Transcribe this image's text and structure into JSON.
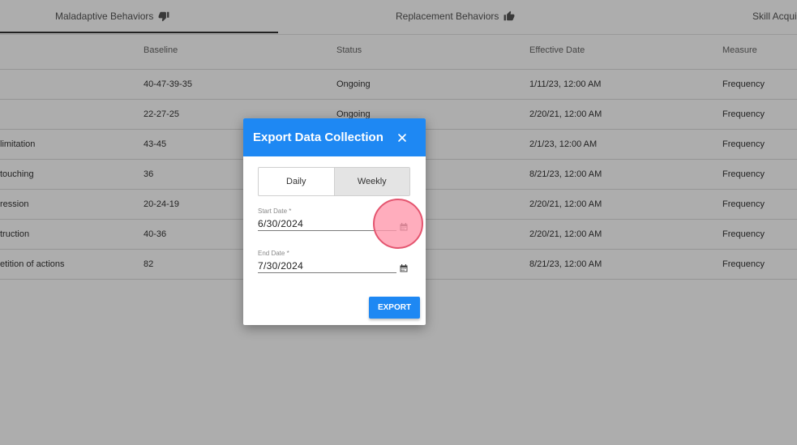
{
  "tabs": [
    {
      "label": "Maladaptive Behaviors",
      "icon": "thumbs-down-icon",
      "active": true
    },
    {
      "label": "Replacement Behaviors",
      "icon": "thumbs-up-icon",
      "active": false
    },
    {
      "label": "Skill Acquis",
      "icon": "",
      "active": false
    }
  ],
  "table": {
    "columns": [
      "",
      "Baseline",
      "Status",
      "Effective Date",
      "Measure"
    ],
    "rows": [
      {
        "name": "",
        "baseline": "40-47-39-35",
        "status": "Ongoing",
        "effective_date": "1/11/23, 12:00 AM",
        "measure": "Frequency"
      },
      {
        "name": "",
        "baseline": "22-27-25",
        "status": "Ongoing",
        "effective_date": "2/20/21, 12:00 AM",
        "measure": "Frequency"
      },
      {
        "name": "limitation",
        "baseline": "43-45",
        "status": "",
        "effective_date": "2/1/23, 12:00 AM",
        "measure": "Frequency"
      },
      {
        "name": "touching",
        "baseline": "36",
        "status": "",
        "effective_date": "8/21/23, 12:00 AM",
        "measure": "Frequency"
      },
      {
        "name": "ression",
        "baseline": "20-24-19",
        "status": "",
        "effective_date": "2/20/21, 12:00 AM",
        "measure": "Frequency"
      },
      {
        "name": "truction",
        "baseline": "40-36",
        "status": "",
        "effective_date": "2/20/21, 12:00 AM",
        "measure": "Frequency"
      },
      {
        "name": "etition of actions",
        "baseline": "82",
        "status": "",
        "effective_date": "8/21/23, 12:00 AM",
        "measure": "Frequency"
      }
    ]
  },
  "modal": {
    "title": "Export Data Collection",
    "close_icon": "close-icon",
    "toggle": {
      "options": [
        "Daily",
        "Weekly"
      ],
      "selected": "Weekly"
    },
    "start_date": {
      "label": "Start Date *",
      "value": "6/30/2024",
      "icon": "calendar-icon"
    },
    "end_date": {
      "label": "End Date *",
      "value": "7/30/2024",
      "icon": "calendar-icon"
    },
    "export_label": "EXPORT"
  },
  "colors": {
    "primary": "#1e88f3",
    "overlay": "rgba(0,0,0,0.32)",
    "click_marker": "#e4556f"
  }
}
